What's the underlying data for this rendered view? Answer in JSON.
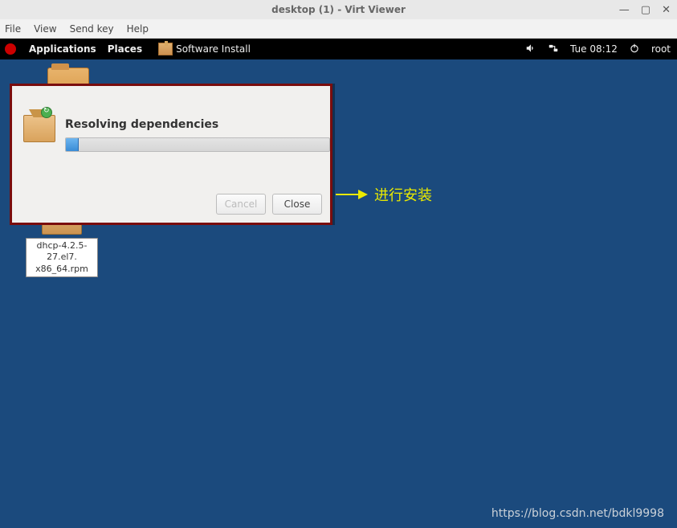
{
  "viewer": {
    "title": "desktop (1) - Virt Viewer",
    "menu": {
      "file": "File",
      "view": "View",
      "sendkey": "Send key",
      "help": "Help"
    }
  },
  "panel": {
    "applications": "Applications",
    "places": "Places",
    "running_app": "Software Install",
    "clock": "Tue 08:12",
    "user": "root"
  },
  "desktop": {
    "rpm_label": "dhcp-4.2.5-27.el7.\nx86_64.rpm"
  },
  "dialog": {
    "title": "Resolving dependencies",
    "cancel": "Cancel",
    "close": "Close"
  },
  "annotation": {
    "text": "进行安装"
  },
  "watermark": "https://blog.csdn.net/bdkl9998"
}
